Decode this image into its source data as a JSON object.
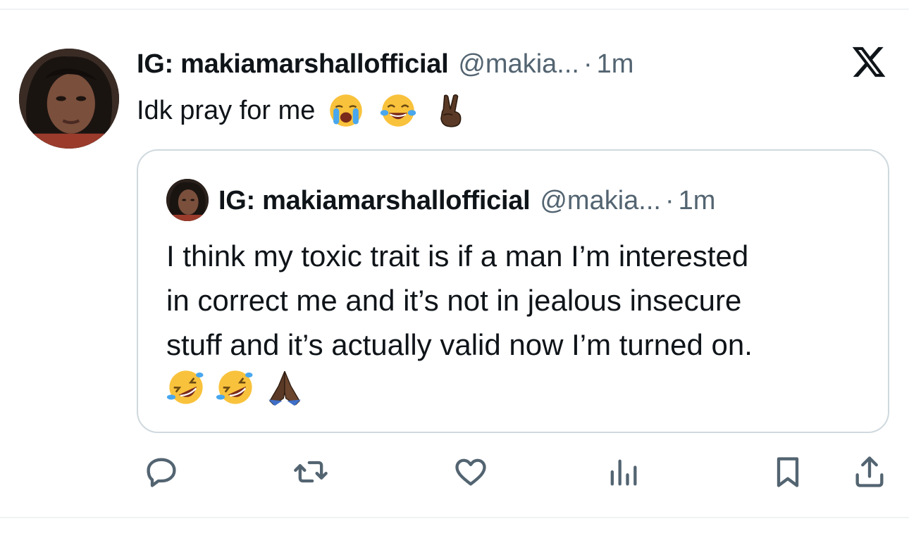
{
  "tweet": {
    "display_name": "IG: makiamarshallofficial",
    "handle": "@makia...",
    "separator": "·",
    "time": "1m",
    "text": "Idk pray for me",
    "emojis": [
      "loudly-crying-face",
      "face-with-tears-of-joy",
      "victory-hand-dark-skin"
    ]
  },
  "quote": {
    "display_name": "IG: makiamarshallofficial",
    "handle": "@makia...",
    "separator": "·",
    "time": "1m",
    "lines": [
      "I think my toxic trait is if a man I’m interested",
      "in correct me and  it’s not in jealous insecure",
      "stuff and it’s actually valid now I’m turned on."
    ],
    "emojis": [
      "rolling-on-the-floor-laughing",
      "rolling-on-the-floor-laughing",
      "folded-hands-dark-skin"
    ]
  },
  "actions": [
    "reply-icon",
    "retweet-icon",
    "like-icon",
    "views-icon",
    "bookmark-icon",
    "share-icon"
  ],
  "colors": {
    "text": "#0f1419",
    "secondary": "#536471",
    "border": "#cfd9de",
    "icon": "#536471"
  }
}
